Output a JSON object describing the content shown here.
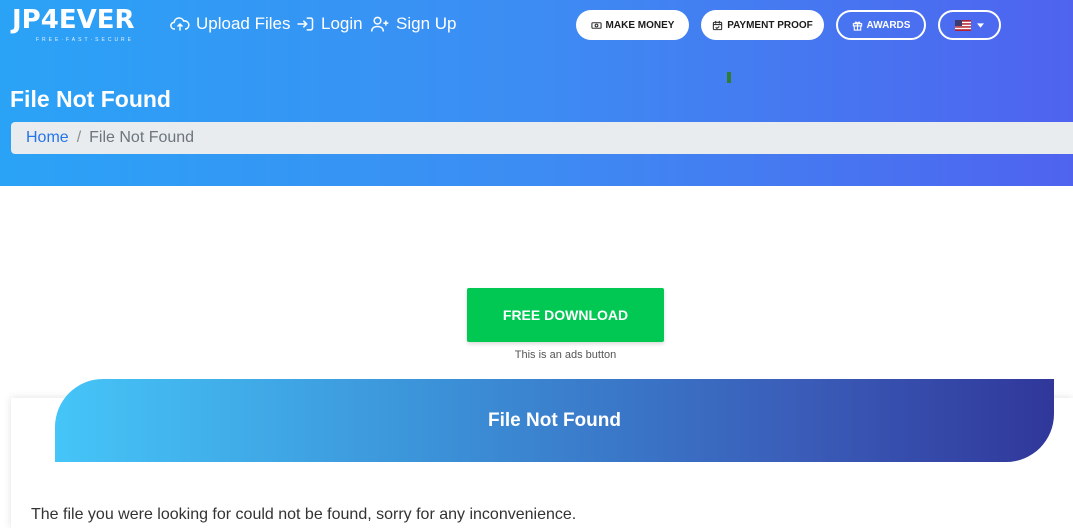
{
  "header": {
    "logo_text": "JP4EVER",
    "logo_tagline": "FREE·FAST·SECURE",
    "nav": {
      "upload": "Upload Files",
      "login": "Login",
      "signup": "Sign Up"
    },
    "buttons": {
      "make_money": "MAKE MONEY",
      "payment_proof": "PAYMENT PROOF",
      "awards": "AWARDS"
    },
    "language_flag": "us-flag-icon"
  },
  "page": {
    "title": "File Not Found",
    "breadcrumb": {
      "home": "Home",
      "separator": "/",
      "current": "File Not Found"
    }
  },
  "ad": {
    "button_label": "FREE DOWNLOAD",
    "note": "This is an ads button"
  },
  "card": {
    "title": "File Not Found",
    "message": "The file you were looking for could not be found, sorry for any inconvenience."
  },
  "colors": {
    "header_gradient_start": "#2aa3f6",
    "header_gradient_end": "#4f63ef",
    "download_green": "#00c853",
    "link_blue": "#2575e8"
  }
}
